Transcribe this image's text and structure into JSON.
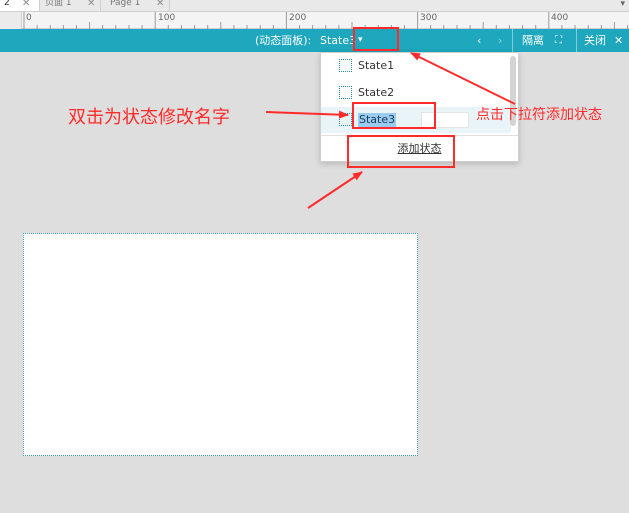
{
  "tabs": [
    {
      "label": "2",
      "close": "✕"
    },
    {
      "label": "页面 1",
      "close": "✕"
    },
    {
      "label": "Page 1",
      "close": "✕"
    }
  ],
  "tab_dropdown": "▾",
  "ruler": {
    "labels": [
      "0",
      "100",
      "200",
      "300",
      "400"
    ]
  },
  "header": {
    "prefix": "(动态面板):",
    "current_state": "State3",
    "caret": "▾",
    "prev": "‹",
    "next": "›",
    "isolate": "隔离",
    "fit_icon": "⛶",
    "close": "关闭",
    "close_x": "✕",
    "color": "#1ea7bd"
  },
  "dropdown": {
    "states": [
      {
        "label": "State1"
      },
      {
        "label": "State2"
      },
      {
        "label": "State3",
        "editing": true
      }
    ],
    "add_state": "添加状态"
  },
  "annotations": {
    "left": "双击为状态修改名字",
    "right": "点击下拉符添加状态",
    "color": "#ff2a2a"
  }
}
